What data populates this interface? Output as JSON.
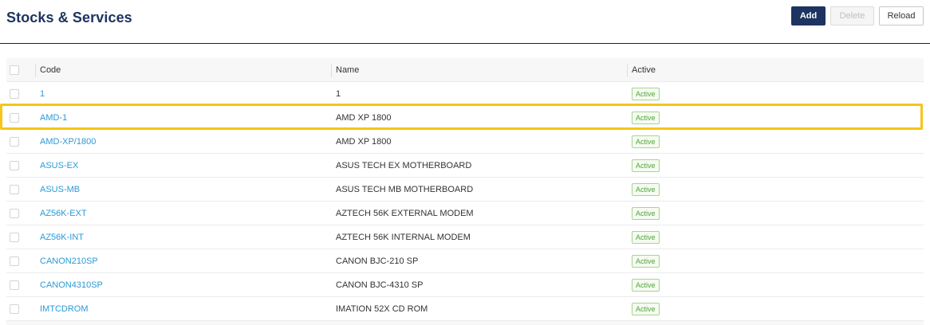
{
  "header": {
    "title": "Stocks & Services",
    "add_label": "Add",
    "delete_label": "Delete",
    "reload_label": "Reload"
  },
  "table": {
    "columns": [
      "Code",
      "Name",
      "Active"
    ],
    "rows": [
      {
        "code": "1",
        "name": "1",
        "status": "Active"
      },
      {
        "code": "AMD-1",
        "name": "AMD XP 1800",
        "status": "Active"
      },
      {
        "code": "AMD-XP/1800",
        "name": "AMD XP 1800",
        "status": "Active"
      },
      {
        "code": "ASUS-EX",
        "name": "ASUS TECH EX MOTHERBOARD",
        "status": "Active"
      },
      {
        "code": "ASUS-MB",
        "name": "ASUS TECH MB MOTHERBOARD",
        "status": "Active"
      },
      {
        "code": "AZ56K-EXT",
        "name": "AZTECH 56K EXTERNAL MODEM",
        "status": "Active"
      },
      {
        "code": "AZ56K-INT",
        "name": "AZTECH 56K INTERNAL MODEM",
        "status": "Active"
      },
      {
        "code": "CANON210SP",
        "name": "CANON BJC-210 SP",
        "status": "Active"
      },
      {
        "code": "CANON4310SP",
        "name": "CANON BJC-4310 SP",
        "status": "Active"
      },
      {
        "code": "IMTCDROM",
        "name": "IMATION 52X CD ROM",
        "status": "Active"
      }
    ]
  },
  "colors": {
    "brand": "#1d3461",
    "link": "#2b9ad7",
    "active_badge": "#52a43a",
    "highlight": "#f5c518"
  }
}
